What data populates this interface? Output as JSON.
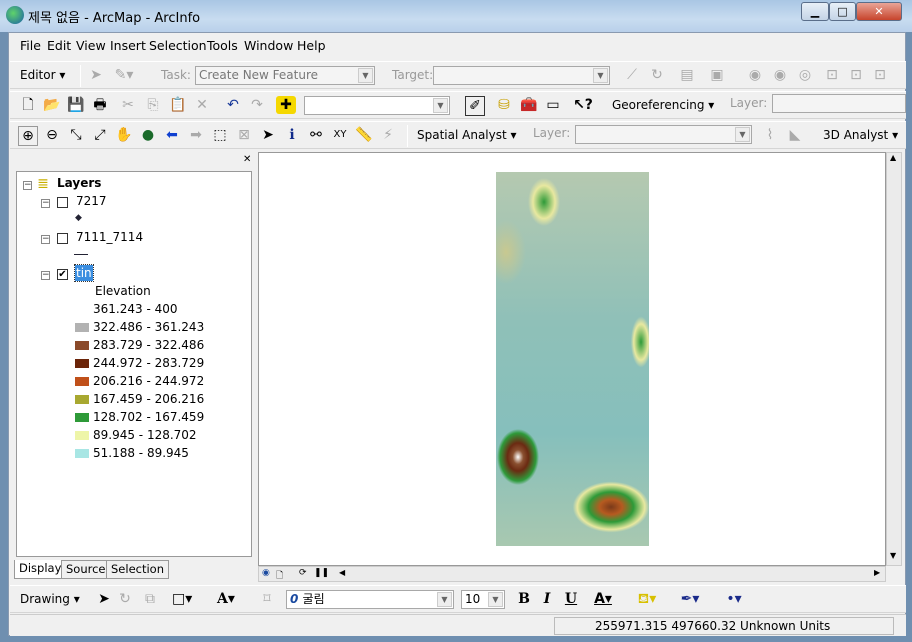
{
  "window": {
    "title": "제목 없음 - ArcMap - ArcInfo",
    "minimize": "▁",
    "maximize": "□",
    "close": "✕"
  },
  "menu": [
    "File",
    "Edit",
    "View",
    "Insert",
    "Selection",
    "Tools",
    "Window",
    "Help"
  ],
  "editor_toolbar": {
    "editor": "Editor ▾",
    "task_label": "Task:",
    "task_value": "Create New Feature",
    "target_label": "Target:",
    "target_value": ""
  },
  "standard_toolbar": {
    "scale_value": "",
    "georeferencing": "Georeferencing ▾",
    "layer_label": "Layer:",
    "layer_value": ""
  },
  "tools_toolbar": {
    "spatial_analyst": "Spatial Analyst ▾",
    "layer_label": "Layer:",
    "layer_value": "",
    "analyst3d": "3D Analyst ▾"
  },
  "toc": {
    "root": "Layers",
    "layers": [
      {
        "name": "7217",
        "checked": false
      },
      {
        "name": "7111_7114",
        "checked": false
      },
      {
        "name": "tin",
        "checked": true
      }
    ],
    "legend_title": "Elevation",
    "legend": [
      {
        "label": "361.243 - 400",
        "color": "#ffffff"
      },
      {
        "label": "322.486 - 361.243",
        "color": "#b2b2b2"
      },
      {
        "label": "283.729 - 322.486",
        "color": "#8b4a2a"
      },
      {
        "label": "244.972 - 283.729",
        "color": "#6b2408"
      },
      {
        "label": "206.216 - 244.972",
        "color": "#c0501a"
      },
      {
        "label": "167.459 - 206.216",
        "color": "#a8a830"
      },
      {
        "label": "128.702 - 167.459",
        "color": "#2e9a38"
      },
      {
        "label": "89.945 - 128.702",
        "color": "#eef5a8"
      },
      {
        "label": "51.188 - 89.945",
        "color": "#a8e6e4"
      }
    ],
    "tabs": [
      "Display",
      "Source",
      "Selection"
    ]
  },
  "drawing_toolbar": {
    "drawing": "Drawing ▾",
    "font": "굴림",
    "size": "10",
    "bold": "B",
    "italic": "I",
    "underline": "U"
  },
  "status": {
    "coordinates": "255971.315  497660.32 Unknown Units"
  }
}
